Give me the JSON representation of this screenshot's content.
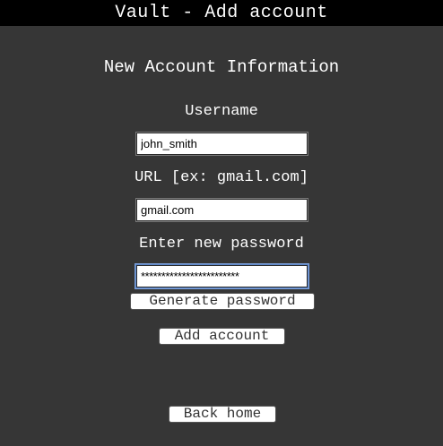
{
  "window": {
    "title": "Vault - Add account"
  },
  "form": {
    "heading": "New Account Information",
    "username_label": "Username",
    "username_value": "john_smith",
    "url_label": "URL [ex: gmail.com]",
    "url_value": "gmail.com",
    "password_label": "Enter new password",
    "password_value": "************************",
    "generate_label": "Generate password",
    "add_label": "Add account"
  },
  "footer": {
    "back_label": "Back home"
  },
  "colors": {
    "background": "#363636",
    "titlebar": "#000000",
    "text": "#ffffff",
    "focus_ring": "#7fa3dd"
  }
}
